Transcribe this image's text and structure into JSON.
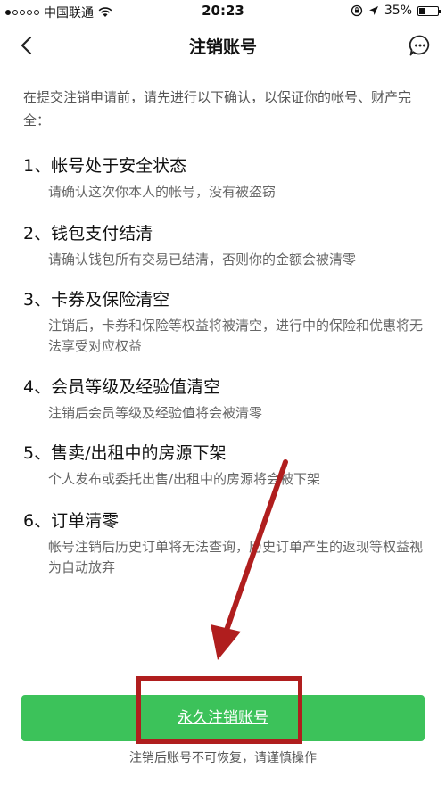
{
  "status_bar": {
    "carrier": "中国联通",
    "time": "20:23",
    "battery": "35%",
    "battery_level": 0.35
  },
  "nav": {
    "title": "注销账号"
  },
  "intro": "在提交注销申请前，请先进行以下确认，以保证你的帐号、财产完全：",
  "items": [
    {
      "title": "1、帐号处于安全状态",
      "desc": "请确认这次你本人的帐号，没有被盗窃"
    },
    {
      "title": "2、钱包支付结清",
      "desc": "请确认钱包所有交易已结清，否则你的金额会被清零"
    },
    {
      "title": "3、卡券及保险清空",
      "desc": "注销后，卡券和保险等权益将被清空，进行中的保险和优惠将无法享受对应权益"
    },
    {
      "title": "4、会员等级及经验值清空",
      "desc": "注销后会员等级及经验值将会被清零"
    },
    {
      "title": "5、售卖/出租中的房源下架",
      "desc": "个人发布或委托出售/出租中的房源将会被下架"
    },
    {
      "title": "6、订单清零",
      "desc": "帐号注销后历史订单将无法查询，历史订单产生的返现等权益视为自动放弃"
    }
  ],
  "action": {
    "button_label": "永久注销账号",
    "warning": "注销后账号不可恢复，请谨慎操作"
  },
  "colors": {
    "button": "#3cc25a",
    "annotation": "#b01e1e"
  },
  "icons": {
    "back": "back-arrow-icon",
    "more": "more-options-icon",
    "wifi": "wifi-icon",
    "location": "location-icon",
    "lock": "rotation-lock-icon"
  }
}
